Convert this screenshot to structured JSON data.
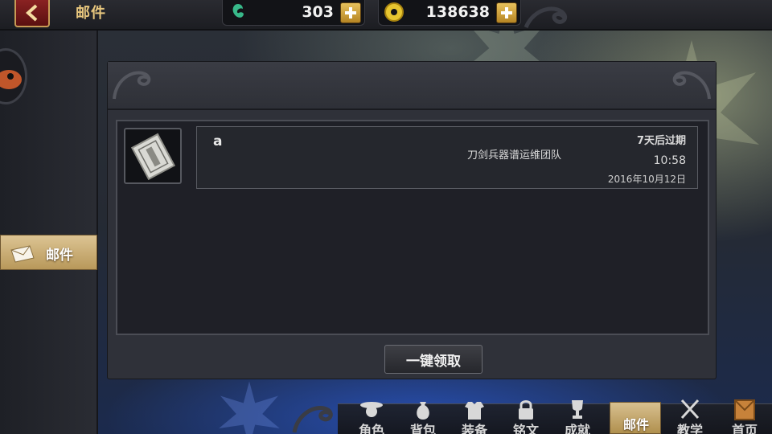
{
  "header": {
    "title": "邮件",
    "currencies": [
      {
        "icon": "jade-icon",
        "amount": "303"
      },
      {
        "icon": "coin-icon",
        "amount": "138638"
      }
    ]
  },
  "sidebar": {
    "tab_label": "邮件"
  },
  "mail_list": [
    {
      "subject": "a",
      "sender": "刀剑兵器谱运维团队",
      "expire": "7天后过期",
      "time": "10:58",
      "date": "2016年10月12日"
    }
  ],
  "actions": {
    "claim_all_label": "一键领取"
  },
  "bottom_nav": [
    {
      "label": "角色",
      "icon": "hat-character-icon",
      "active": false
    },
    {
      "label": "背包",
      "icon": "bag-icon",
      "active": false
    },
    {
      "label": "装备",
      "icon": "armor-icon",
      "active": false
    },
    {
      "label": "铭文",
      "icon": "lock-icon",
      "active": false
    },
    {
      "label": "成就",
      "icon": "trophy-icon",
      "active": false
    },
    {
      "label": "邮件",
      "icon": "mail-icon",
      "active": true
    },
    {
      "label": "教学",
      "icon": "crossed-swords-icon",
      "active": false
    },
    {
      "label": "首页",
      "icon": "home-icon",
      "active": false
    }
  ],
  "colors": {
    "accent_gold": "#dcc493",
    "title_gold": "#e8c77e",
    "panel": "#2f3139"
  }
}
